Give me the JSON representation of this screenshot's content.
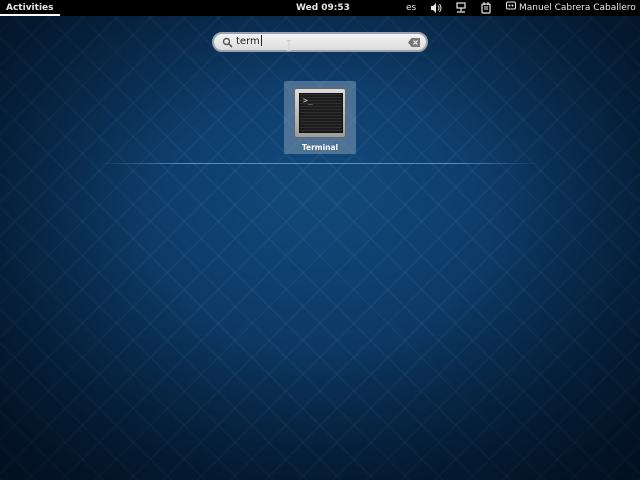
{
  "topbar": {
    "activities_label": "Activities",
    "clock": "Wed 09:53",
    "keyboard_layout": "es",
    "user_name": "Manuel Cabrera Caballero",
    "icons": [
      "volume-icon",
      "network-icon",
      "power-icon",
      "user-status-icon"
    ]
  },
  "search": {
    "value": "term",
    "icon": "search-icon",
    "clear_icon": "clear-icon"
  },
  "results": {
    "apps": [
      {
        "label": "Terminal",
        "icon": "terminal-icon",
        "prompt": ">_"
      }
    ]
  },
  "colors": {
    "background": "#0d3a66",
    "topbar": "#000000",
    "selection": "#8fa3b8"
  }
}
